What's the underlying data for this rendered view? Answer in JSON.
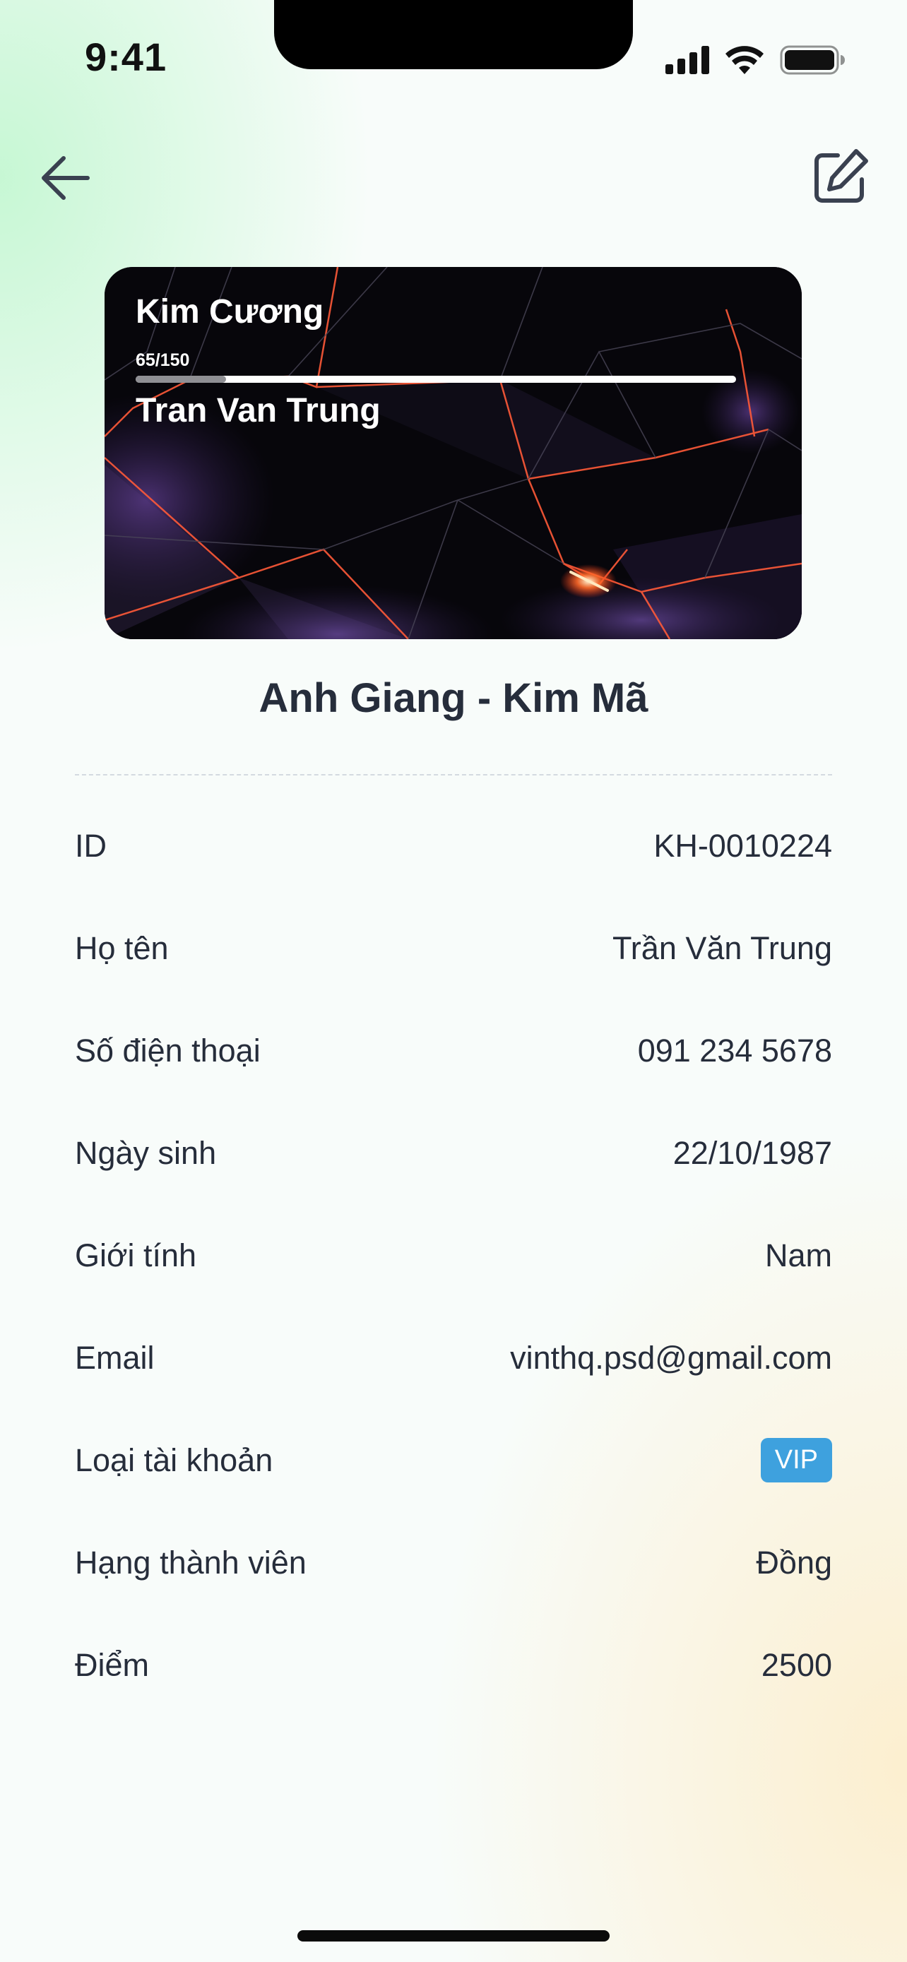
{
  "status_bar": {
    "time": "9:41",
    "icons": [
      "cellular-signal-icon",
      "wifi-icon",
      "battery-icon"
    ]
  },
  "nav": {
    "back_icon": "arrow-left-icon",
    "edit_icon": "edit-icon"
  },
  "card": {
    "tier": "Kim Cương",
    "progress_text": "65/150",
    "progress_fraction": 0.15,
    "holder_name": "Tran Van Trung"
  },
  "store_name": "Anh Giang - Kim Mã",
  "info": {
    "id_label": "ID",
    "id_value": "KH-0010224",
    "name_label": "Họ tên",
    "name_value": "Trần Văn Trung",
    "phone_label": "Số điện thoại",
    "phone_value": "091 234 5678",
    "birthday_label": "Ngày sinh",
    "birthday_value": "22/10/1987",
    "gender_label": "Giới tính",
    "gender_value": "Nam",
    "email_label": "Email",
    "email_value": "vinthq.psd@gmail.com",
    "account_type_label": "Loại tài khoản",
    "account_type_value": "VIP",
    "rank_label": "Hạng thành viên",
    "rank_value": "Đồng",
    "points_label": "Điểm",
    "points_value": "2500"
  },
  "colors": {
    "vip_badge": "#3ea1de",
    "text_primary": "#262d3b",
    "card_background": "#07060b",
    "card_accent": "#ff6a3d"
  }
}
